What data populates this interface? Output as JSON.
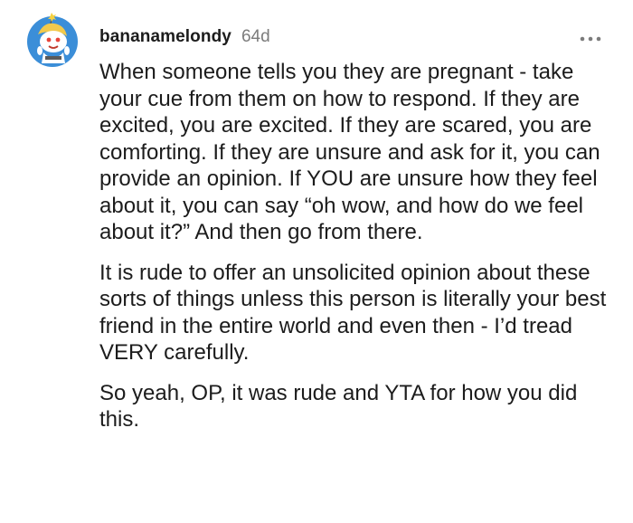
{
  "comment": {
    "username": "bananamelondy",
    "timestamp": "64d",
    "avatar_icon": "snoo-avatar-icon",
    "more_icon": "more-options-icon",
    "colors": {
      "text": "#1c1c1c",
      "meta": "#7c7c7c",
      "avatar_bg": "#3b8ed8"
    },
    "paragraphs": [
      "When someone tells you they are pregnant - take your cue from them on how to respond. If they are excited, you are excited. If they are scared, you are comforting. If they are unsure and ask for it, you can provide an opinion. If YOU are unsure how they feel about it, you can say “oh wow, and how do we feel about it?” And then go from there.",
      "It is rude to offer an unsolicited opinion about these sorts of things unless this person is literally your best friend in the entire world and even then - I’d tread VERY carefully.",
      "So yeah, OP, it was rude and YTA for how you did this."
    ]
  }
}
